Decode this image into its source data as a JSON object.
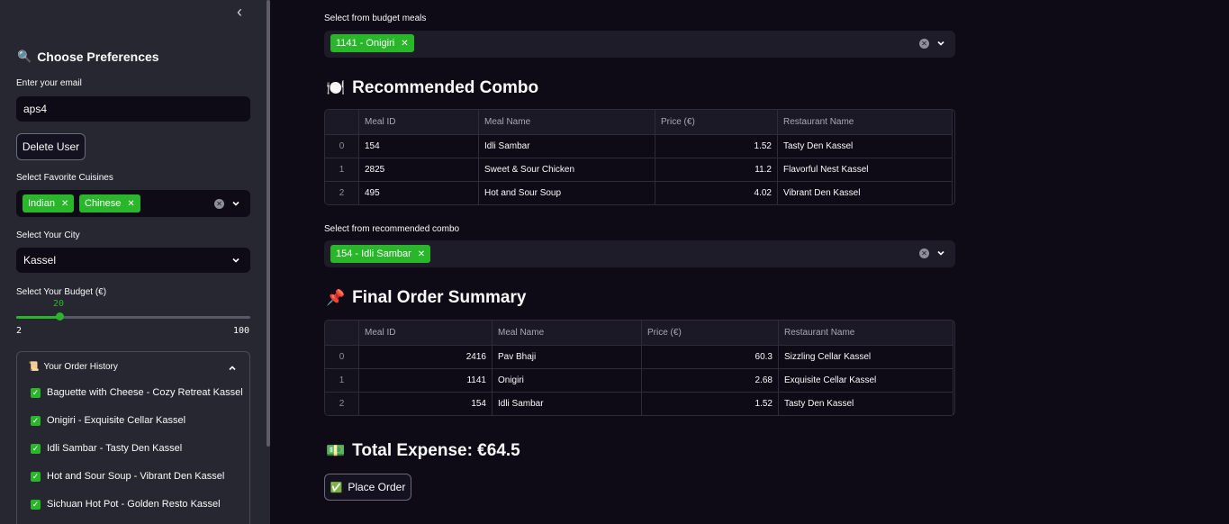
{
  "sidebar": {
    "collapse_glyph": "‹",
    "title": "Choose Preferences",
    "title_icon": "🔍",
    "email_label": "Enter your email",
    "email_value": "aps4",
    "delete_button": "Delete User",
    "cuisines_label": "Select Favorite Cuisines",
    "cuisines": [
      "Indian",
      "Chinese"
    ],
    "city_label": "Select Your City",
    "city_value": "Kassel",
    "budget_label": "Select Your Budget (€)",
    "budget_value": "20",
    "budget_min": "2",
    "budget_max": "100",
    "budget_fraction": 0.184,
    "history_title": "Your Order History",
    "history_icon": "📜",
    "history_items": [
      "Baguette with Cheese - Cozy Retreat Kassel",
      "Onigiri - Exquisite Cellar Kassel",
      "Idli Sambar - Tasty Den Kassel",
      "Hot and Sour Soup - Vibrant Den Kassel",
      "Sichuan Hot Pot - Golden Resto Kassel"
    ]
  },
  "main": {
    "budget_meals_label": "Select from budget meals",
    "budget_meals_selected": "1141 - Onigiri",
    "combo_title": "Recommended Combo",
    "combo_icon": "🍽️",
    "combo_table": {
      "headers": [
        "Meal ID",
        "Meal Name",
        "Price (€)",
        "Restaurant Name"
      ],
      "rows": [
        [
          "0",
          "154",
          "Idli Sambar",
          "1.52",
          "Tasty Den Kassel"
        ],
        [
          "1",
          "2825",
          "Sweet & Sour Chicken",
          "11.2",
          "Flavorful Nest Kassel"
        ],
        [
          "2",
          "495",
          "Hot and Sour Soup",
          "4.02",
          "Vibrant Den Kassel"
        ]
      ]
    },
    "combo_select_label": "Select from recommended combo",
    "combo_selected": "154 - Idli Sambar",
    "summary_title": "Final Order Summary",
    "summary_icon": "📌",
    "summary_table": {
      "headers": [
        "Meal ID",
        "Meal Name",
        "Price (€)",
        "Restaurant Name"
      ],
      "rows": [
        [
          "0",
          "2416",
          "Pav Bhaji",
          "60.3",
          "Sizzling Cellar Kassel"
        ],
        [
          "1",
          "1141",
          "Onigiri",
          "2.68",
          "Exquisite Cellar Kassel"
        ],
        [
          "2",
          "154",
          "Idli Sambar",
          "1.52",
          "Tasty Den Kassel"
        ]
      ]
    },
    "expense_title": "Total Expense: €64.5",
    "expense_icon": "💵",
    "place_order": "Place Order",
    "place_order_icon": "✅"
  },
  "colors": {
    "accent": "#29b62a",
    "sidebar_bg": "#262730",
    "main_bg": "#0e0b16"
  }
}
